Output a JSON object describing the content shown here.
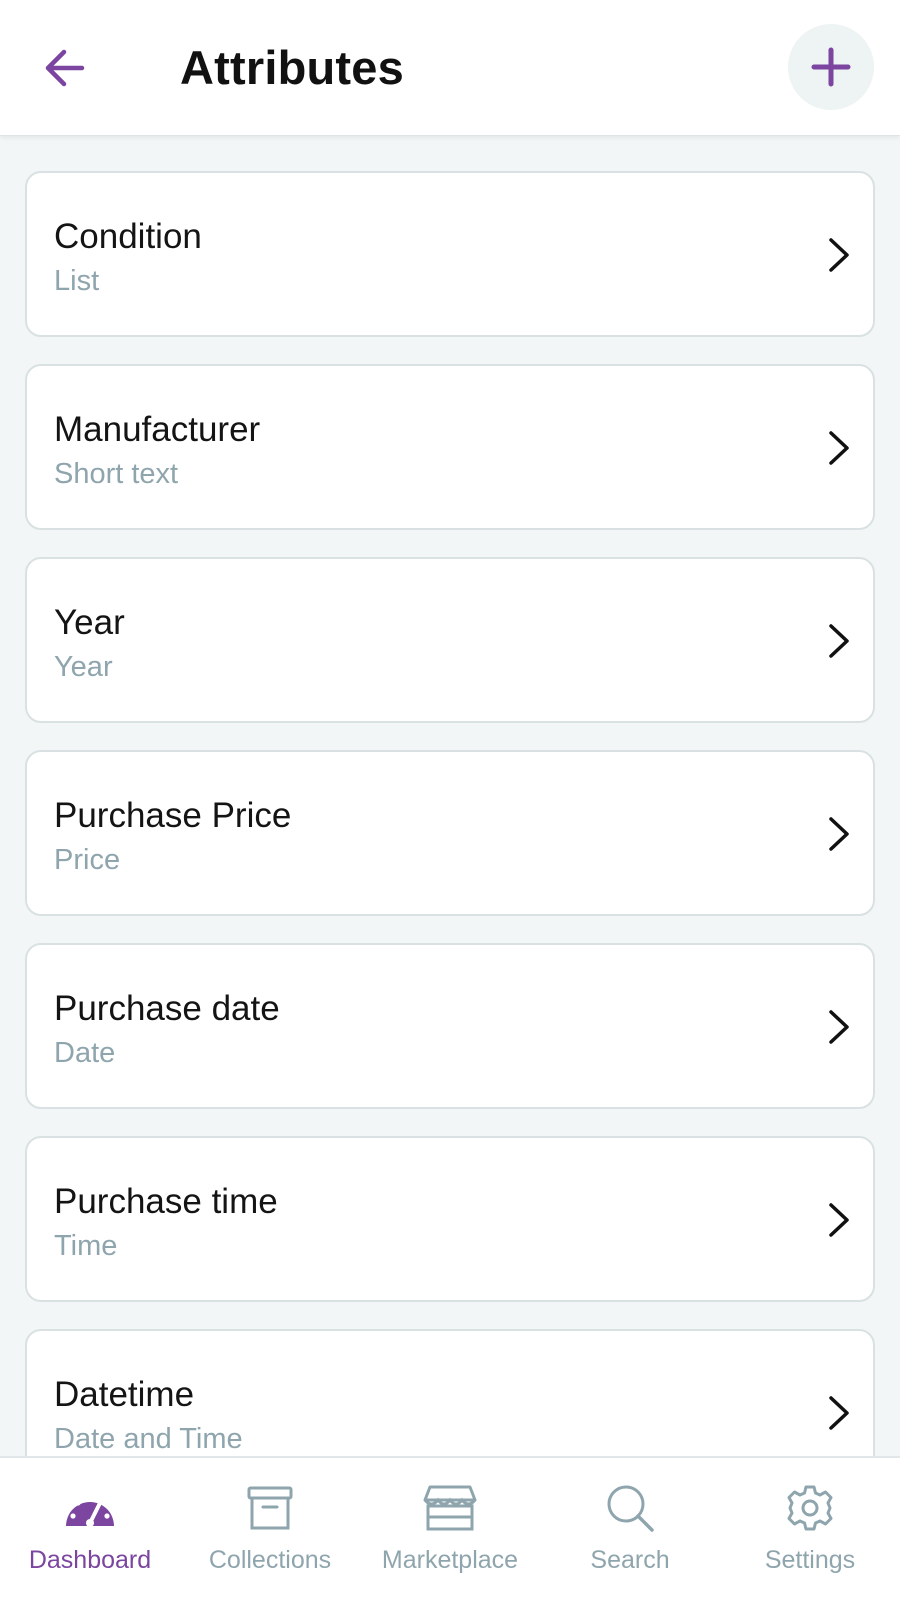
{
  "header": {
    "title": "Attributes",
    "back_icon": "arrow-left-icon",
    "add_icon": "plus-icon",
    "accent": "#7b45a0"
  },
  "attributes": [
    {
      "name": "Condition",
      "type": "List"
    },
    {
      "name": "Manufacturer",
      "type": "Short text"
    },
    {
      "name": "Year",
      "type": "Year"
    },
    {
      "name": "Purchase Price",
      "type": "Price"
    },
    {
      "name": "Purchase date",
      "type": "Date"
    },
    {
      "name": "Purchase time",
      "type": "Time"
    },
    {
      "name": "Datetime",
      "type": "Date and Time"
    }
  ],
  "bottom_nav": [
    {
      "label": "Dashboard",
      "icon": "gauge-icon",
      "active": true
    },
    {
      "label": "Collections",
      "icon": "archive-box-icon",
      "active": false
    },
    {
      "label": "Marketplace",
      "icon": "storefront-icon",
      "active": false
    },
    {
      "label": "Search",
      "icon": "search-icon",
      "active": false
    },
    {
      "label": "Settings",
      "icon": "gear-icon",
      "active": false
    }
  ],
  "colors": {
    "background": "#f2f6f6",
    "card_border": "#d9e1e2",
    "muted_text": "#8fa5ad",
    "active_nav": "#7b45a0"
  }
}
